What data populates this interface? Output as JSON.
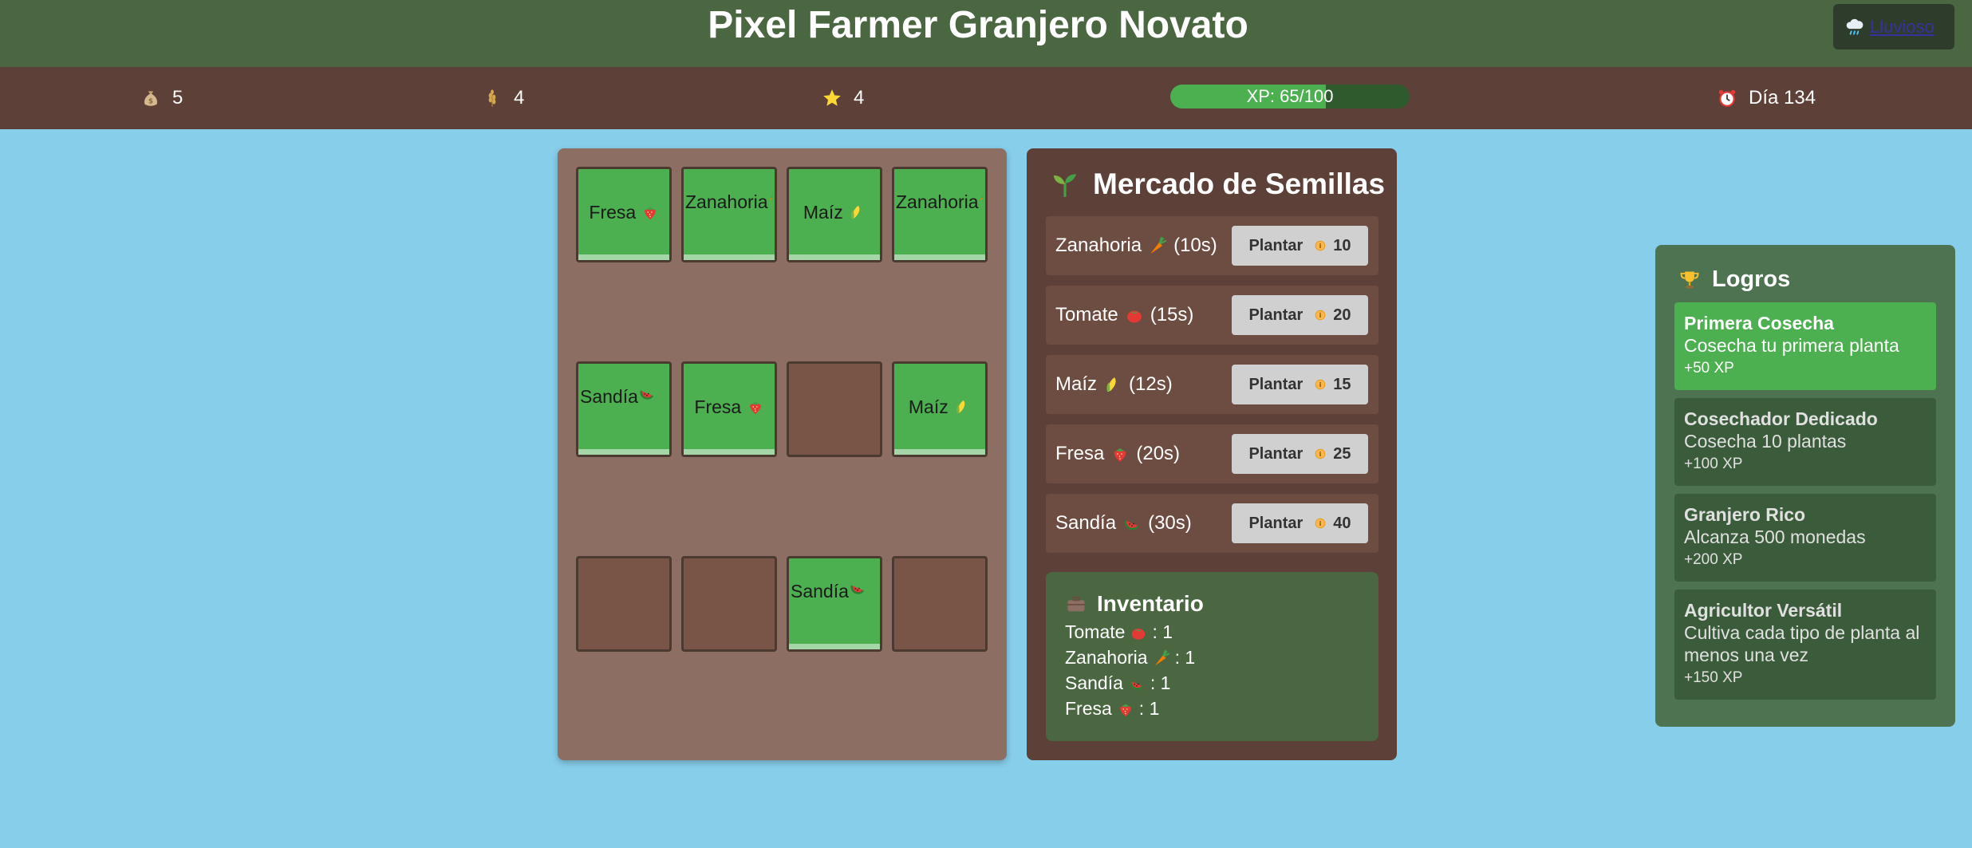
{
  "header": {
    "title": "Pixel Farmer Granjero Novato",
    "weather_label": "Lluvioso",
    "weather_icon": "rain-cloud-icon"
  },
  "stats": {
    "coins": "5",
    "harvested": "4",
    "level": "4",
    "xp_text": "XP: 65/100",
    "xp_progress": 0.65,
    "day": "Día 134"
  },
  "field": {
    "plots": [
      {
        "crop": "Fresa",
        "state": "grown"
      },
      {
        "crop": "Zanahoria",
        "state": "grown"
      },
      {
        "crop": "Maíz",
        "state": "grown"
      },
      {
        "crop": "Zanahoria",
        "state": "grown"
      },
      {
        "crop": "Sandía",
        "state": "grown"
      },
      {
        "crop": "Fresa",
        "state": "grown"
      },
      {
        "crop": "",
        "state": "empty"
      },
      {
        "crop": "Maíz",
        "state": "grown"
      },
      {
        "crop": "",
        "state": "empty"
      },
      {
        "crop": "",
        "state": "empty"
      },
      {
        "crop": "Sandía",
        "state": "grown"
      },
      {
        "crop": "",
        "state": "empty"
      }
    ]
  },
  "market": {
    "title": "Mercado de Semillas",
    "seeds": [
      {
        "name": "Zanahoria",
        "time": "(10s)",
        "button": "Plantar",
        "price": "10",
        "icon": "carrot-icon"
      },
      {
        "name": "Tomate",
        "time": "(15s)",
        "button": "Plantar",
        "price": "20",
        "icon": "tomato-icon"
      },
      {
        "name": "Maíz",
        "time": "(12s)",
        "button": "Plantar",
        "price": "15",
        "icon": "corn-icon"
      },
      {
        "name": "Fresa",
        "time": "(20s)",
        "button": "Plantar",
        "price": "25",
        "icon": "strawberry-icon"
      },
      {
        "name": "Sandía",
        "time": "(30s)",
        "button": "Plantar",
        "price": "40",
        "icon": "watermelon-icon"
      }
    ]
  },
  "inventory": {
    "title": "Inventario",
    "items": [
      {
        "name": "Tomate",
        "count": ": 1",
        "icon": "tomato-icon"
      },
      {
        "name": "Zanahoria",
        "count": ": 1",
        "icon": "carrot-icon"
      },
      {
        "name": "Sandía",
        "count": ": 1",
        "icon": "watermelon-icon"
      },
      {
        "name": "Fresa",
        "count": ": 1",
        "icon": "strawberry-icon"
      }
    ]
  },
  "achievements": {
    "title": "Logros",
    "items": [
      {
        "name": "Primera Cosecha",
        "desc": "Cosecha tu primera planta",
        "xp": "+50 XP",
        "unlocked": true
      },
      {
        "name": "Cosechador Dedicado",
        "desc": "Cosecha 10 plantas",
        "xp": "+100 XP",
        "unlocked": false
      },
      {
        "name": "Granjero Rico",
        "desc": "Alcanza 500 monedas",
        "xp": "+200 XP",
        "unlocked": false
      },
      {
        "name": "Agricultor Versátil",
        "desc": "Cultiva cada tipo de planta al menos una vez",
        "xp": "+150 XP",
        "unlocked": false
      }
    ]
  },
  "colors": {
    "header_bg": "#4a6741",
    "statsbar_bg": "#5d4037",
    "sky_bg": "#87ceeb",
    "plot_grown": "#4caf50",
    "plot_empty": "#795548"
  }
}
